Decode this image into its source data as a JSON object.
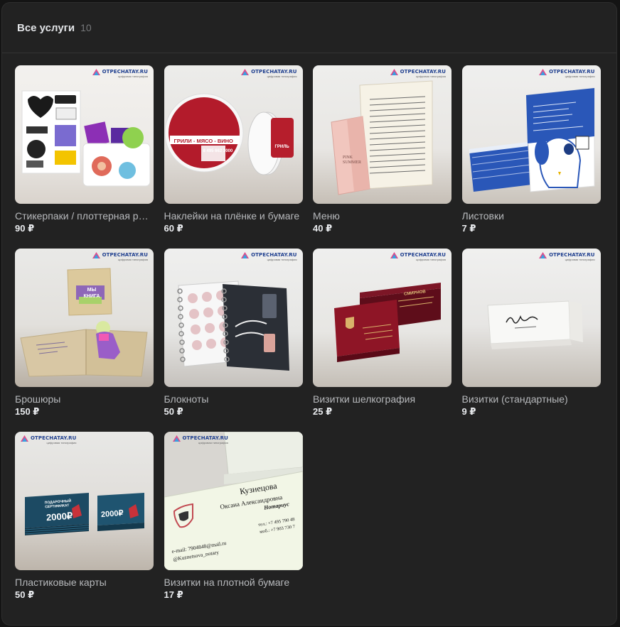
{
  "header": {
    "title": "Все услуги",
    "count": "10"
  },
  "brand": {
    "logo": "OTPECHATAY.RU",
    "tagline": "цифровая типография"
  },
  "items": [
    {
      "name": "Стикерпаки / плоттерная резка",
      "price": "90 ₽"
    },
    {
      "name": "Наклейки на плёнке и бумаге",
      "price": "60 ₽",
      "image_text": [
        "ГРИЛИ - МЯСО - ВИНО",
        "8 495 662 3000",
        "ГРИЛЬ"
      ]
    },
    {
      "name": "Меню",
      "price": "40 ₽",
      "image_text": [
        "PINK SUMMER"
      ]
    },
    {
      "name": "Листовки",
      "price": "7 ₽"
    },
    {
      "name": "Брошюры",
      "price": "150 ₽",
      "image_text": [
        "МЫ КНИГА"
      ]
    },
    {
      "name": "Блокноты",
      "price": "50 ₽"
    },
    {
      "name": "Визитки шелкография",
      "price": "25 ₽",
      "image_text": [
        "СМИРНОВ"
      ]
    },
    {
      "name": "Визитки (стандартные)",
      "price": "9 ₽"
    },
    {
      "name": "Пластиковые карты",
      "price": "50 ₽",
      "image_text": [
        "ПОДАРОЧНЫЙ СЕРТИФИКАТ",
        "2000₽"
      ]
    },
    {
      "name": "Визитки на плотной бумаге",
      "price": "17 ₽",
      "image_text": [
        "Кузнецова",
        "Оксана Александровна",
        "Нотариус",
        "тел.: +7 495 790 48",
        "моб.: +7 903 730 7",
        "e-mail: 7904848@mail.ru",
        "@Kuznetsova_notary"
      ]
    }
  ]
}
